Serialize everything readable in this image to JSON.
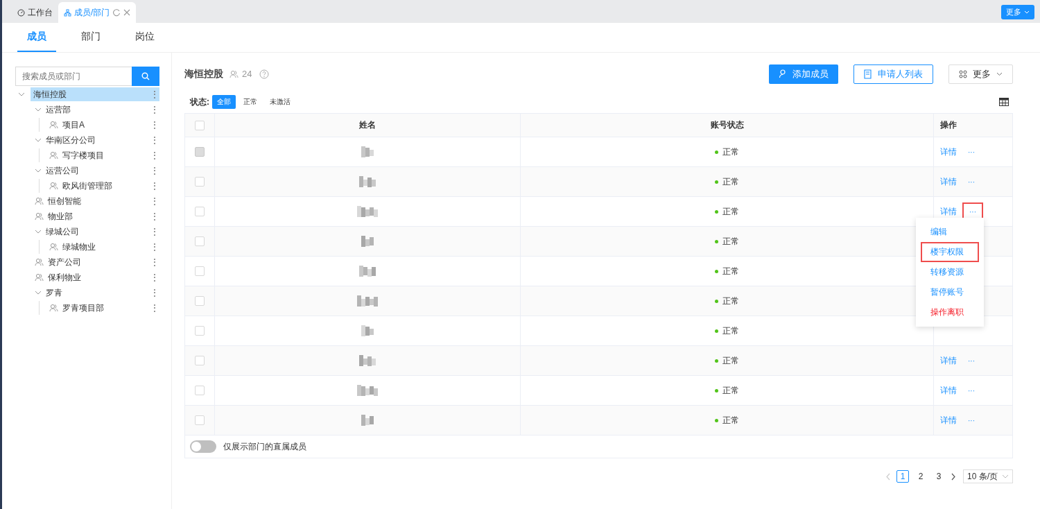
{
  "browser_tabs": [
    {
      "label": "工作台",
      "selected": false,
      "closable": false
    },
    {
      "label": "成员/部门",
      "selected": true,
      "closable": true
    }
  ],
  "top_more": {
    "label": "更多"
  },
  "page_tabs": [
    {
      "label": "成员",
      "selected": true
    },
    {
      "label": "部门",
      "selected": false
    },
    {
      "label": "岗位",
      "selected": false
    }
  ],
  "search": {
    "placeholder": "搜索成员或部门"
  },
  "tree": [
    {
      "label": "海恒控股",
      "expanded": true,
      "selected": true,
      "children": [
        {
          "label": "运营部",
          "expanded": true,
          "selected": false,
          "children": [
            {
              "label": "项目A",
              "selected": false
            }
          ]
        },
        {
          "label": "华南区分公司",
          "expanded": true,
          "selected": false,
          "children": [
            {
              "label": "写字楼项目",
              "selected": false
            }
          ]
        },
        {
          "label": "运营公司",
          "expanded": true,
          "selected": false,
          "children": [
            {
              "label": "欧风街管理部",
              "selected": false
            }
          ]
        },
        {
          "label": "恒创智能",
          "selected": false
        },
        {
          "label": "物业部",
          "selected": false
        },
        {
          "label": "绿城公司",
          "expanded": true,
          "selected": false,
          "children": [
            {
              "label": "绿城物业",
              "selected": false
            }
          ]
        },
        {
          "label": "资产公司",
          "selected": false
        },
        {
          "label": "保利物业",
          "selected": false
        },
        {
          "label": "罗青",
          "expanded": true,
          "selected": false,
          "children": [
            {
              "label": "罗青项目部",
              "selected": false
            }
          ]
        }
      ]
    }
  ],
  "header": {
    "title": "海恒控股",
    "member_count": "24"
  },
  "buttons": [
    {
      "label": "添加成员",
      "kind": "primary"
    },
    {
      "label": "申请人列表",
      "kind": "outline"
    },
    {
      "label": "更多",
      "kind": "dropdown"
    }
  ],
  "status_filter": {
    "label": "状态:",
    "options": [
      {
        "label": "全部",
        "selected": true
      },
      {
        "label": "正常",
        "selected": false
      },
      {
        "label": "未激活",
        "selected": false
      }
    ]
  },
  "table": {
    "select_all": {
      "checked": false
    },
    "columns": [
      "姓名",
      "账号状态",
      "操作"
    ],
    "rows": [
      {
        "disabled": true,
        "status": "正常",
        "detail": "详情",
        "more": "···",
        "highlighted": false
      },
      {
        "disabled": false,
        "status": "正常",
        "detail": "详情",
        "more": "···",
        "highlighted": false
      },
      {
        "disabled": false,
        "status": "正常",
        "detail": "详情",
        "more": "···",
        "highlighted": true
      },
      {
        "disabled": false,
        "status": "正常"
      },
      {
        "disabled": false,
        "status": "正常"
      },
      {
        "disabled": false,
        "status": "正常"
      },
      {
        "disabled": false,
        "status": "正常"
      },
      {
        "disabled": false,
        "status": "正常",
        "detail": "详情",
        "more": "···",
        "highlighted": false
      },
      {
        "disabled": false,
        "status": "正常",
        "detail": "详情",
        "more": "···",
        "highlighted": false
      },
      {
        "disabled": false,
        "status": "正常",
        "detail": "详情",
        "more": "···",
        "highlighted": false
      }
    ]
  },
  "row_menu": {
    "items": [
      {
        "label": "编辑",
        "kind": "normal",
        "highlighted": false
      },
      {
        "label": "楼宇权限",
        "kind": "normal",
        "highlighted": true
      },
      {
        "label": "转移资源",
        "kind": "normal",
        "highlighted": false
      },
      {
        "label": "暂停账号",
        "kind": "normal",
        "highlighted": false
      },
      {
        "label": "操作离职",
        "kind": "danger",
        "highlighted": false
      }
    ]
  },
  "toggle": {
    "label": "仅展示部门的直属成员",
    "on": false
  },
  "pagination": {
    "pages": [
      {
        "label": "1",
        "selected": true
      },
      {
        "label": "2",
        "selected": false
      },
      {
        "label": "3",
        "selected": false
      }
    ],
    "page_size": "10 条/页"
  }
}
